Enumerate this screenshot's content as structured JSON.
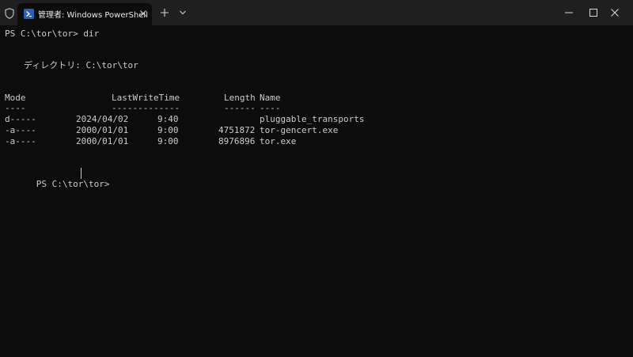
{
  "window": {
    "tab_title": "管理者: Windows PowerShell",
    "icons": {
      "shield": "shield-icon",
      "powershell": "powershell-icon",
      "close_tab": "close-icon",
      "new_tab": "plus-icon",
      "dropdown": "chevron-down-icon",
      "minimize": "minimize-icon",
      "maximize": "maximize-icon",
      "close_window": "close-icon"
    }
  },
  "terminal": {
    "prompt1": "PS C:\\tor\\tor> dir",
    "directory_label": "ディレクトリ: C:\\tor\\tor",
    "headers": {
      "mode": "Mode",
      "lastwrite": "LastWriteTime",
      "length": "Length",
      "name": "Name"
    },
    "underlines": {
      "mode": "----",
      "lastwrite": "-------------",
      "length": "------",
      "name": "----"
    },
    "rows": [
      {
        "mode": "d-----",
        "date": "2024/04/02",
        "time": "9:40",
        "length": "",
        "name": "pluggable_transports"
      },
      {
        "mode": "-a----",
        "date": "2000/01/01",
        "time": "9:00",
        "length": "4751872",
        "name": "tor-gencert.exe"
      },
      {
        "mode": "-a----",
        "date": "2000/01/01",
        "time": "9:00",
        "length": "8976896",
        "name": "tor.exe"
      }
    ],
    "prompt2": "PS C:\\tor\\tor> "
  },
  "colors": {
    "background": "#0c0c0c",
    "titlebar": "#1f1f1f",
    "text": "#cccccc",
    "accent": "#2d5fb3"
  }
}
